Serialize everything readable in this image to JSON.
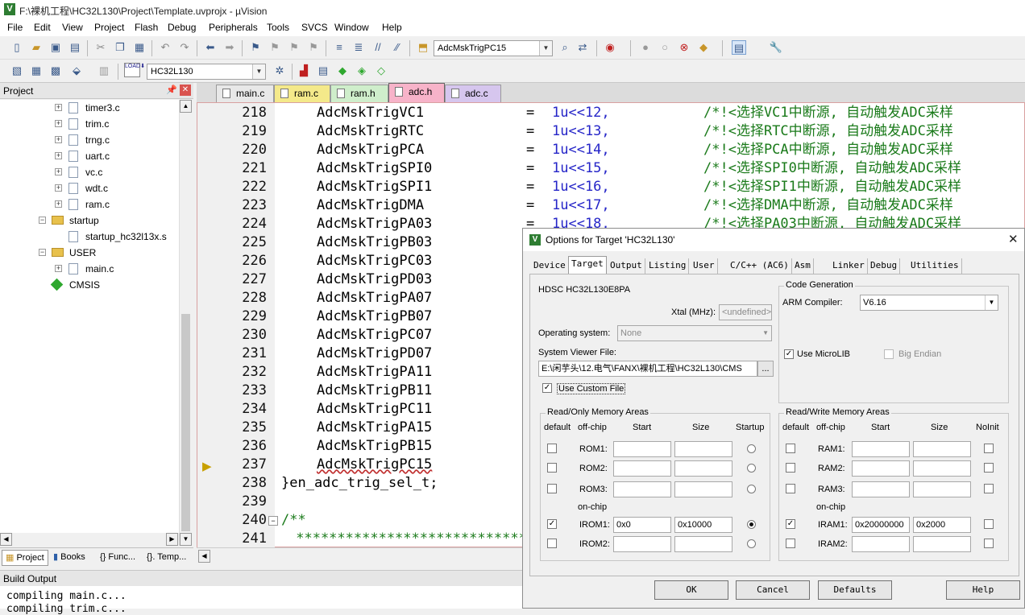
{
  "window": {
    "title": "F:\\裸机工程\\HC32L130\\Project\\Template.uvprojx - µVision"
  },
  "menu": [
    "File",
    "Edit",
    "View",
    "Project",
    "Flash",
    "Debug",
    "Peripherals",
    "Tools",
    "SVCS",
    "Window",
    "Help"
  ],
  "toolbar": {
    "find_combo": "AdcMskTrigPC15",
    "target_combo": "HC32L130",
    "load_label": "LOAD"
  },
  "project_panel": {
    "title": "Project",
    "tree": [
      {
        "label": "timer3.c",
        "type": "file",
        "expander": "+"
      },
      {
        "label": "trim.c",
        "type": "file",
        "expander": "+"
      },
      {
        "label": "trng.c",
        "type": "file",
        "expander": "+"
      },
      {
        "label": "uart.c",
        "type": "file",
        "expander": "+"
      },
      {
        "label": "vc.c",
        "type": "file",
        "expander": "+"
      },
      {
        "label": "wdt.c",
        "type": "file",
        "expander": "+"
      },
      {
        "label": "ram.c",
        "type": "file",
        "expander": "+"
      },
      {
        "label": "startup",
        "type": "folder",
        "expander": "-"
      },
      {
        "label": "startup_hc32l13x.s",
        "type": "file",
        "expander": ""
      },
      {
        "label": "USER",
        "type": "folder",
        "expander": "-"
      },
      {
        "label": "main.c",
        "type": "file",
        "expander": "+"
      },
      {
        "label": "CMSIS",
        "type": "component",
        "expander": ""
      }
    ],
    "tabs": [
      "Project",
      "Books",
      "{} Func...",
      "{}. Temp..."
    ]
  },
  "editor_tabs": [
    {
      "label": "main.c",
      "color": "#e8e8e8"
    },
    {
      "label": "ram.c",
      "color": "#f4e98a"
    },
    {
      "label": "ram.h",
      "color": "#cfeecb"
    },
    {
      "label": "adc.h",
      "color": "#f7b3c9"
    },
    {
      "label": "adc.c",
      "color": "#d6c6ee"
    }
  ],
  "code_lines": [
    {
      "n": "218",
      "name": "AdcMskTrigVC1",
      "op": "=",
      "val": "1u<<12,",
      "cmt": "/*!<选择VC1中断源, 自动触发ADC采样"
    },
    {
      "n": "219",
      "name": "AdcMskTrigRTC",
      "op": "=",
      "val": "1u<<13,",
      "cmt": "/*!<选择RTC中断源, 自动触发ADC采样"
    },
    {
      "n": "220",
      "name": "AdcMskTrigPCA",
      "op": "=",
      "val": "1u<<14,",
      "cmt": "/*!<选择PCA中断源, 自动触发ADC采样"
    },
    {
      "n": "221",
      "name": "AdcMskTrigSPI0",
      "op": "=",
      "val": "1u<<15,",
      "cmt": "/*!<选择SPI0中断源, 自动触发ADC采样"
    },
    {
      "n": "222",
      "name": "AdcMskTrigSPI1",
      "op": "=",
      "val": "1u<<16,",
      "cmt": "/*!<选择SPI1中断源, 自动触发ADC采样"
    },
    {
      "n": "223",
      "name": "AdcMskTrigDMA",
      "op": "=",
      "val": "1u<<17,",
      "cmt": "/*!<选择DMA中断源, 自动触发ADC采样"
    },
    {
      "n": "224",
      "name": "AdcMskTrigPA03",
      "op": "=",
      "val": "1u<<18,",
      "cmt": "/*!<选择PA03中断源, 自动触发ADC采样"
    },
    {
      "n": "225",
      "name": "AdcMskTrigPB03",
      "op": "",
      "val": "",
      "cmt": ""
    },
    {
      "n": "226",
      "name": "AdcMskTrigPC03",
      "op": "",
      "val": "",
      "cmt": ""
    },
    {
      "n": "227",
      "name": "AdcMskTrigPD03",
      "op": "",
      "val": "",
      "cmt": ""
    },
    {
      "n": "228",
      "name": "AdcMskTrigPA07",
      "op": "",
      "val": "",
      "cmt": ""
    },
    {
      "n": "229",
      "name": "AdcMskTrigPB07",
      "op": "",
      "val": "",
      "cmt": ""
    },
    {
      "n": "230",
      "name": "AdcMskTrigPC07",
      "op": "",
      "val": "",
      "cmt": ""
    },
    {
      "n": "231",
      "name": "AdcMskTrigPD07",
      "op": "",
      "val": "",
      "cmt": ""
    },
    {
      "n": "232",
      "name": "AdcMskTrigPA11",
      "op": "",
      "val": "",
      "cmt": ""
    },
    {
      "n": "233",
      "name": "AdcMskTrigPB11",
      "op": "",
      "val": "",
      "cmt": ""
    },
    {
      "n": "234",
      "name": "AdcMskTrigPC11",
      "op": "",
      "val": "",
      "cmt": ""
    },
    {
      "n": "235",
      "name": "AdcMskTrigPA15",
      "op": "",
      "val": "",
      "cmt": ""
    },
    {
      "n": "236",
      "name": "AdcMskTrigPB15",
      "op": "",
      "val": "",
      "cmt": ""
    },
    {
      "n": "237",
      "name": "AdcMskTrigPC15",
      "op": "",
      "val": "",
      "cmt": ""
    },
    {
      "n": "238",
      "name": "}en_adc_trig_sel_t;",
      "op": "",
      "val": "",
      "cmt": ""
    },
    {
      "n": "239",
      "name": "",
      "op": "",
      "val": "",
      "cmt": ""
    },
    {
      "n": "240",
      "name": "",
      "op": "",
      "val": "",
      "cmt": "/**"
    },
    {
      "n": "241",
      "name": "",
      "op": "",
      "val": "",
      "cmt": " *********************************"
    }
  ],
  "build_output": {
    "title": "Build Output",
    "lines": [
      "compiling main.c...",
      "compiling trim.c..."
    ]
  },
  "dialog": {
    "title": "Options for Target 'HC32L130'",
    "tabs": [
      "Device",
      "Target",
      "Output",
      "Listing",
      "User",
      "C/C++ (AC6)",
      "Asm",
      "Linker",
      "Debug",
      "Utilities"
    ],
    "active_tab": "Target",
    "device": "HDSC HC32L130E8PA",
    "xtal_label": "Xtal (MHz):",
    "xtal_value": "<undefined>",
    "os_label": "Operating system:",
    "os_value": "None",
    "svf_label": "System Viewer File:",
    "svf_value": "E:\\闲芋头\\12.电气\\FANX\\裸机工程\\HC32L130\\CMS",
    "browse": "...",
    "use_custom_file": "Use Custom File",
    "code_gen_title": "Code Generation",
    "arm_compiler_label": "ARM Compiler:",
    "arm_compiler_value": "V6.16",
    "use_microlib": "Use MicroLIB",
    "big_endian": "Big Endian",
    "ro_title": "Read/Only Memory Areas",
    "rw_title": "Read/Write Memory Areas",
    "col_default": "default",
    "col_offchip": "off-chip",
    "col_start": "Start",
    "col_size": "Size",
    "col_startup": "Startup",
    "col_noinit": "NoInit",
    "on_chip": "on-chip",
    "ro_rows": [
      {
        "name": "ROM1:",
        "start": "",
        "size": "",
        "checked": false,
        "radio": false
      },
      {
        "name": "ROM2:",
        "start": "",
        "size": "",
        "checked": false,
        "radio": false
      },
      {
        "name": "ROM3:",
        "start": "",
        "size": "",
        "checked": false,
        "radio": false
      },
      {
        "name": "IROM1:",
        "start": "0x0",
        "size": "0x10000",
        "checked": true,
        "radio": true
      },
      {
        "name": "IROM2:",
        "start": "",
        "size": "",
        "checked": false,
        "radio": false
      }
    ],
    "rw_rows": [
      {
        "name": "RAM1:",
        "start": "",
        "size": "",
        "checked": false
      },
      {
        "name": "RAM2:",
        "start": "",
        "size": "",
        "checked": false
      },
      {
        "name": "RAM3:",
        "start": "",
        "size": "",
        "checked": false
      },
      {
        "name": "IRAM1:",
        "start": "0x20000000",
        "size": "0x2000",
        "checked": true
      },
      {
        "name": "IRAM2:",
        "start": "",
        "size": "",
        "checked": false
      }
    ],
    "buttons": [
      "OK",
      "Cancel",
      "Defaults",
      "Help"
    ]
  }
}
